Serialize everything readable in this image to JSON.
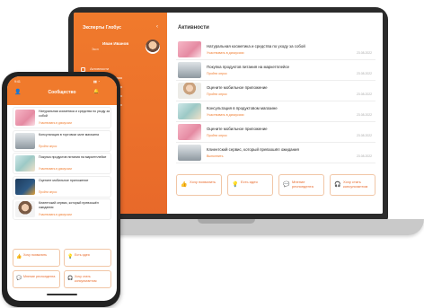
{
  "laptop": {
    "sidebar": {
      "title": "Эксперты Глобус",
      "collapse_icon": "chevron-left-icon",
      "user_name": "Иван Иванов",
      "user_role": "Эксп",
      "menu": [
        "Активности",
        "",
        "",
        "",
        ""
      ]
    },
    "main": {
      "title": "Активности",
      "activities": [
        {
          "title": "Натуральная косметика и средства по уходу за собой",
          "subtitle": "Участвовать в дискуссии",
          "date": "23.08.2022",
          "thumb": "pink"
        },
        {
          "title": "Покупка продуктов питания на маркетплейсе",
          "subtitle": "Пройти опрос",
          "date": "23.08.2022",
          "thumb": "store"
        },
        {
          "title": "Оцените мобильное приложение",
          "subtitle": "Пройти опрос",
          "date": "23.08.2022",
          "thumb": "woman"
        },
        {
          "title": "Консультация в продуктовом магазине",
          "subtitle": "Участвовать в дискуссии",
          "date": "23.08.2022",
          "thumb": "shop"
        },
        {
          "title": "Оцените мобильное приложение",
          "subtitle": "Пройти опрос",
          "date": "23.08.2022",
          "thumb": "pink"
        },
        {
          "title": "Клиентский сервис, который превзошёл ожидания",
          "subtitle": "Выполнить",
          "date": "23.08.2022",
          "thumb": "store"
        }
      ],
      "buttons": [
        {
          "label": "Хочу похвалить",
          "icon": "thumbs-up-icon"
        },
        {
          "label": "Есть идея",
          "icon": "lightbulb-icon"
        },
        {
          "label": "Мнение респондента",
          "icon": "chat-icon"
        },
        {
          "label": "Хочу стать консультантом",
          "icon": "headset-icon"
        }
      ]
    }
  },
  "phone": {
    "time": "9:41",
    "signal": "▮▮ ◔",
    "header_title": "Сообщество",
    "cards": [
      {
        "title": "Натуральная косметика и средства по уходу за собой",
        "subtitle": "Участвовать в дискуссии",
        "thumb": "pink"
      },
      {
        "title": "Консультация в торговом зале магазина",
        "subtitle": "Пройти опрос",
        "thumb": "store"
      },
      {
        "title": "Покупка продуктов питания на маркетплейсе",
        "subtitle": "Участвовать в дискуссии",
        "thumb": "shop"
      },
      {
        "title": "Оцените мобильное приложение",
        "subtitle": "Пройти опрос",
        "thumb": "navy"
      },
      {
        "title": "Клиентский сервис, который превзошёл ожидания",
        "subtitle": "Участвовать в дискуссии",
        "thumb": "face"
      }
    ],
    "buttons": [
      {
        "label": "Хочу похвалить",
        "icon": "thumbs-up-icon"
      },
      {
        "label": "Есть идея",
        "icon": "lightbulb-icon"
      },
      {
        "label": "Мнение респондента",
        "icon": "chat-icon"
      },
      {
        "label": "Хочу стать консультантом",
        "icon": "headset-icon"
      }
    ]
  },
  "colors": {
    "accent": "#f07a2c",
    "accent_dark": "#e8692a"
  }
}
